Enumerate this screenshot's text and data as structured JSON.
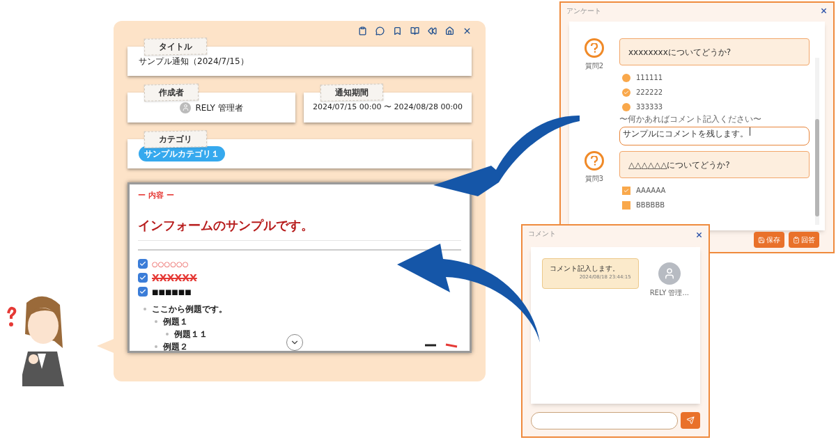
{
  "notice": {
    "title_label": "タイトル",
    "title": "サンプル通知（2024/7/15）",
    "author_label": "作成者",
    "author": "RELY 管理者",
    "period_label": "通知期間",
    "period": "2024/07/15 00:00 〜 2024/08/28 00:00",
    "category_label": "カテゴリ",
    "category_tag": "サンプルカテゴリ１",
    "content": {
      "label": "ー 内容 ー",
      "heading": "インフォームのサンプルです。",
      "checklist": [
        {
          "text": "○○○○○○",
          "kind": "small",
          "checked": true
        },
        {
          "text": "XXXXXX",
          "kind": "strike",
          "checked": true
        },
        {
          "text": "■■■■■■",
          "kind": "bold",
          "checked": true
        }
      ],
      "outline": [
        {
          "text": "ここから例題です。",
          "children": [
            {
              "text": "例題１",
              "children": [
                {
                  "text": "例題１１"
                }
              ]
            },
            {
              "text": "例題２"
            }
          ]
        }
      ]
    }
  },
  "survey": {
    "title": "アンケート",
    "questions": [
      {
        "label": "質問2",
        "text": "xxxxxxxxについてどうか?",
        "kind": "radio",
        "options": [
          {
            "text": "111111",
            "selected": false
          },
          {
            "text": "222222",
            "selected": true
          },
          {
            "text": "333333",
            "selected": false
          }
        ],
        "comment_hint": "〜何かあればコメント記入ください〜",
        "comment": "サンプルにコメントを残します。"
      },
      {
        "label": "質問3",
        "text": "△△△△△△についてどうか?",
        "kind": "checkbox",
        "options": [
          {
            "text": "AAAAAA",
            "checked": true
          },
          {
            "text": "BBBBBB",
            "checked": false
          }
        ]
      }
    ],
    "buttons": [
      {
        "label": "保存",
        "kind": "save"
      },
      {
        "label": "回答",
        "kind": "answer"
      }
    ]
  },
  "comments": {
    "title": "コメント",
    "messages": [
      {
        "text": "コメント記入します。",
        "time": "2024/08/18 23:44:15",
        "author": "RELY 管理..."
      }
    ]
  }
}
